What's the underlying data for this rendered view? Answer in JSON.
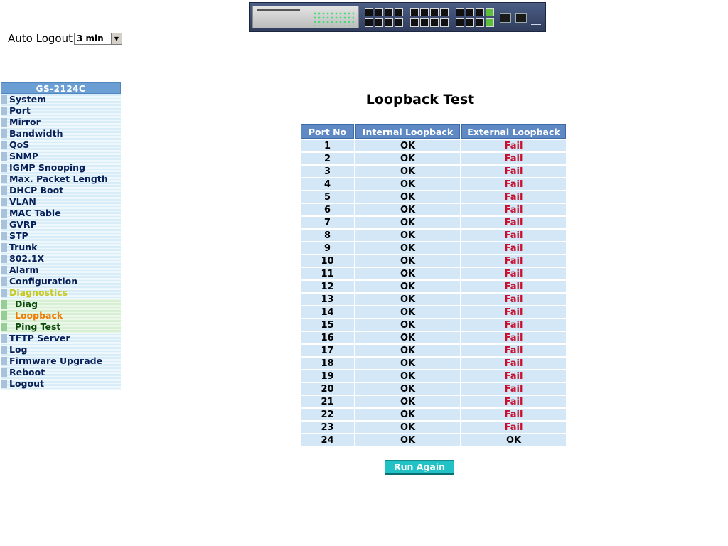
{
  "auto_logout": {
    "label": "Auto Logout",
    "selected": "3 min"
  },
  "sidebar": {
    "header": "GS-2124C",
    "items": [
      {
        "label": "System",
        "type": "item"
      },
      {
        "label": "Port",
        "type": "item"
      },
      {
        "label": "Mirror",
        "type": "item"
      },
      {
        "label": "Bandwidth",
        "type": "item"
      },
      {
        "label": "QoS",
        "type": "item"
      },
      {
        "label": "SNMP",
        "type": "item"
      },
      {
        "label": "IGMP Snooping",
        "type": "item"
      },
      {
        "label": "Max. Packet Length",
        "type": "item"
      },
      {
        "label": "DHCP Boot",
        "type": "item"
      },
      {
        "label": "VLAN",
        "type": "item"
      },
      {
        "label": "MAC Table",
        "type": "item"
      },
      {
        "label": "GVRP",
        "type": "item"
      },
      {
        "label": "STP",
        "type": "item"
      },
      {
        "label": "Trunk",
        "type": "item"
      },
      {
        "label": "802.1X",
        "type": "item"
      },
      {
        "label": "Alarm",
        "type": "item"
      },
      {
        "label": "Configuration",
        "type": "item"
      },
      {
        "label": "Diagnostics",
        "type": "active"
      },
      {
        "label": "Diag",
        "type": "sub"
      },
      {
        "label": "Loopback",
        "type": "sub-current"
      },
      {
        "label": "Ping Test",
        "type": "sub"
      },
      {
        "label": "TFTP Server",
        "type": "item"
      },
      {
        "label": "Log",
        "type": "item"
      },
      {
        "label": "Firmware Upgrade",
        "type": "item"
      },
      {
        "label": "Reboot",
        "type": "item"
      },
      {
        "label": "Logout",
        "type": "item"
      }
    ]
  },
  "main": {
    "title": "Loopback Test",
    "columns": [
      "Port No",
      "Internal Loopback",
      "External Loopback"
    ],
    "rows": [
      {
        "port": "1",
        "internal": "OK",
        "external": "Fail"
      },
      {
        "port": "2",
        "internal": "OK",
        "external": "Fail"
      },
      {
        "port": "3",
        "internal": "OK",
        "external": "Fail"
      },
      {
        "port": "4",
        "internal": "OK",
        "external": "Fail"
      },
      {
        "port": "5",
        "internal": "OK",
        "external": "Fail"
      },
      {
        "port": "6",
        "internal": "OK",
        "external": "Fail"
      },
      {
        "port": "7",
        "internal": "OK",
        "external": "Fail"
      },
      {
        "port": "8",
        "internal": "OK",
        "external": "Fail"
      },
      {
        "port": "9",
        "internal": "OK",
        "external": "Fail"
      },
      {
        "port": "10",
        "internal": "OK",
        "external": "Fail"
      },
      {
        "port": "11",
        "internal": "OK",
        "external": "Fail"
      },
      {
        "port": "12",
        "internal": "OK",
        "external": "Fail"
      },
      {
        "port": "13",
        "internal": "OK",
        "external": "Fail"
      },
      {
        "port": "14",
        "internal": "OK",
        "external": "Fail"
      },
      {
        "port": "15",
        "internal": "OK",
        "external": "Fail"
      },
      {
        "port": "16",
        "internal": "OK",
        "external": "Fail"
      },
      {
        "port": "17",
        "internal": "OK",
        "external": "Fail"
      },
      {
        "port": "18",
        "internal": "OK",
        "external": "Fail"
      },
      {
        "port": "19",
        "internal": "OK",
        "external": "Fail"
      },
      {
        "port": "20",
        "internal": "OK",
        "external": "Fail"
      },
      {
        "port": "21",
        "internal": "OK",
        "external": "Fail"
      },
      {
        "port": "22",
        "internal": "OK",
        "external": "Fail"
      },
      {
        "port": "23",
        "internal": "OK",
        "external": "Fail"
      },
      {
        "port": "24",
        "internal": "OK",
        "external": "OK"
      }
    ],
    "run_again_label": "Run Again"
  },
  "colors": {
    "fail": "#c8102e",
    "header_bg": "#5e89c4",
    "cell_bg": "#d3e7f7",
    "button_bg": "#21c2c6",
    "active_menu": "#c7c91b",
    "current_submenu": "#f07a00"
  },
  "icons": {
    "menu_bullet": "square-bullet-icon",
    "select_arrow": "chevron-down-icon"
  }
}
